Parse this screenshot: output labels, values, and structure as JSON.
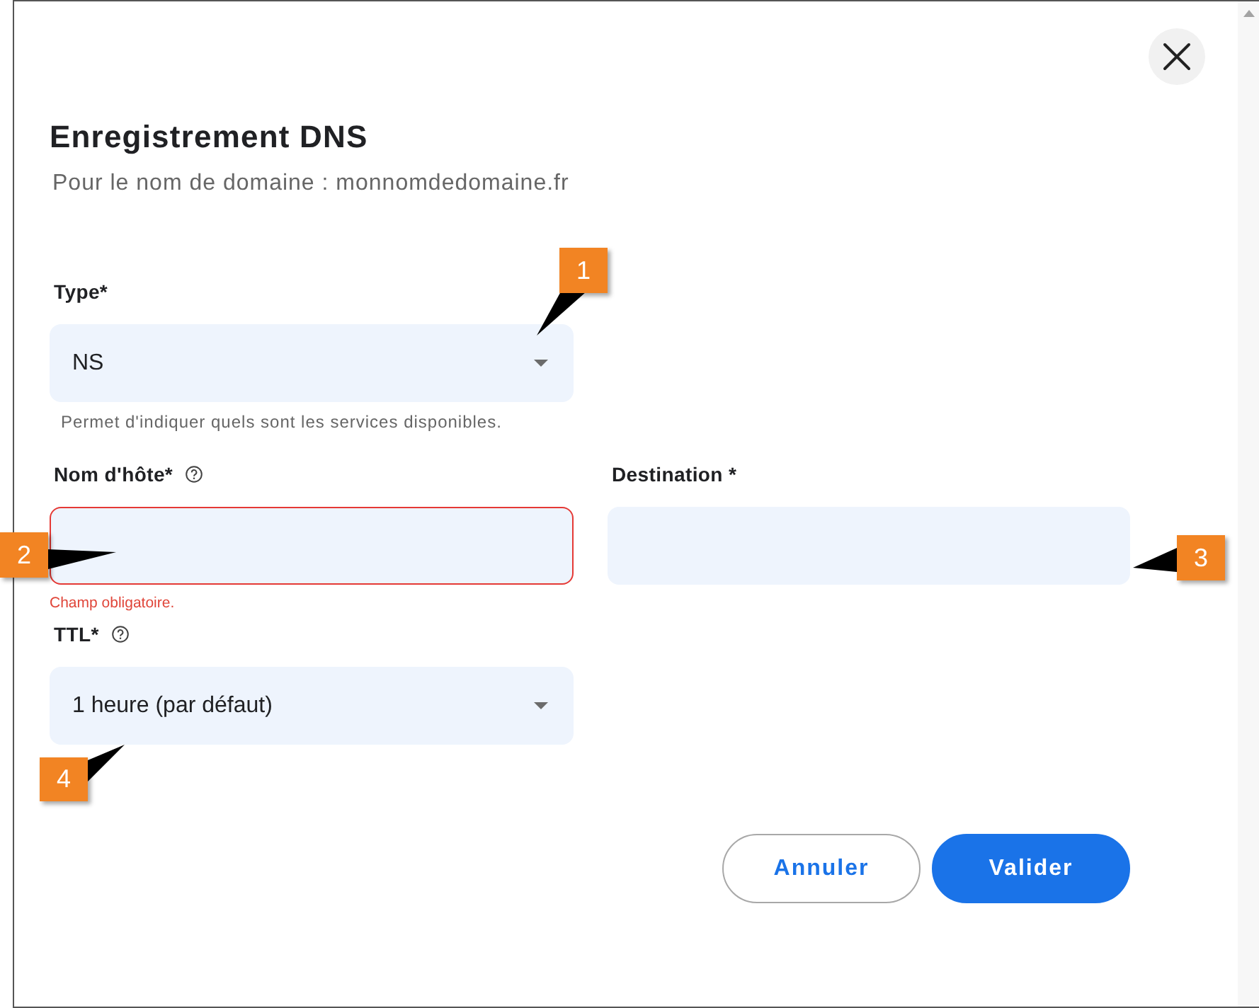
{
  "dialog": {
    "title": "Enregistrement DNS",
    "subtitle": "Pour le nom de domaine : monnomdedomaine.fr"
  },
  "form_rows": [
    [
      {
        "kind": "select",
        "label": "Type*",
        "help": false,
        "value": "NS",
        "invalid": false,
        "message": "Permet d'indiquer quels sont les services disponibles."
      }
    ],
    [
      {
        "kind": "input",
        "label": "Nom d'hôte*",
        "help": true,
        "invalid": true,
        "message": "Champ obligatoire."
      },
      {
        "kind": "input",
        "label": "Destination *",
        "help": false,
        "invalid": false
      }
    ],
    [
      {
        "kind": "select",
        "label": "TTL*",
        "help": true,
        "value": "1 heure (par défaut)",
        "invalid": false
      }
    ]
  ],
  "buttons": [
    {
      "kind": "secondary",
      "label": "Annuler"
    },
    {
      "kind": "primary",
      "label": "Valider"
    }
  ],
  "callouts": [
    {
      "label": "1"
    },
    {
      "label": "2"
    },
    {
      "label": "3"
    },
    {
      "label": "4"
    }
  ]
}
